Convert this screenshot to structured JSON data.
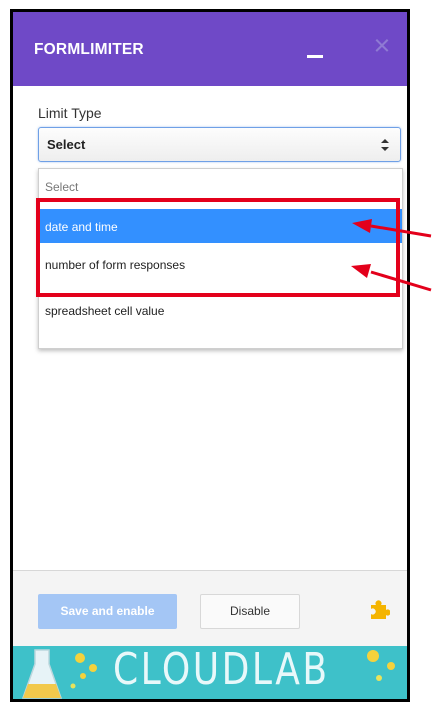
{
  "header": {
    "title": "FORMLIMITER"
  },
  "form": {
    "limit_type_label": "Limit Type",
    "select_value": "Select"
  },
  "dropdown": {
    "options": [
      {
        "label": "Select"
      },
      {
        "label": "date and time"
      },
      {
        "label": "number of form responses"
      },
      {
        "label": "spreadsheet cell value"
      }
    ],
    "highlighted_index": 1
  },
  "footer": {
    "save_label": "Save and enable",
    "disable_label": "Disable"
  },
  "banner": {
    "brand": "CLOUDLAB"
  },
  "colors": {
    "header": "#6f49c7",
    "selected_option": "#3390ff",
    "annotation": "#e3001b",
    "banner": "#3ec1c9",
    "save_button": "#a4c6f5"
  },
  "icons": [
    "minimize-icon",
    "close-icon",
    "select-arrows-icon",
    "puzzle-icon",
    "flask-icon"
  ]
}
